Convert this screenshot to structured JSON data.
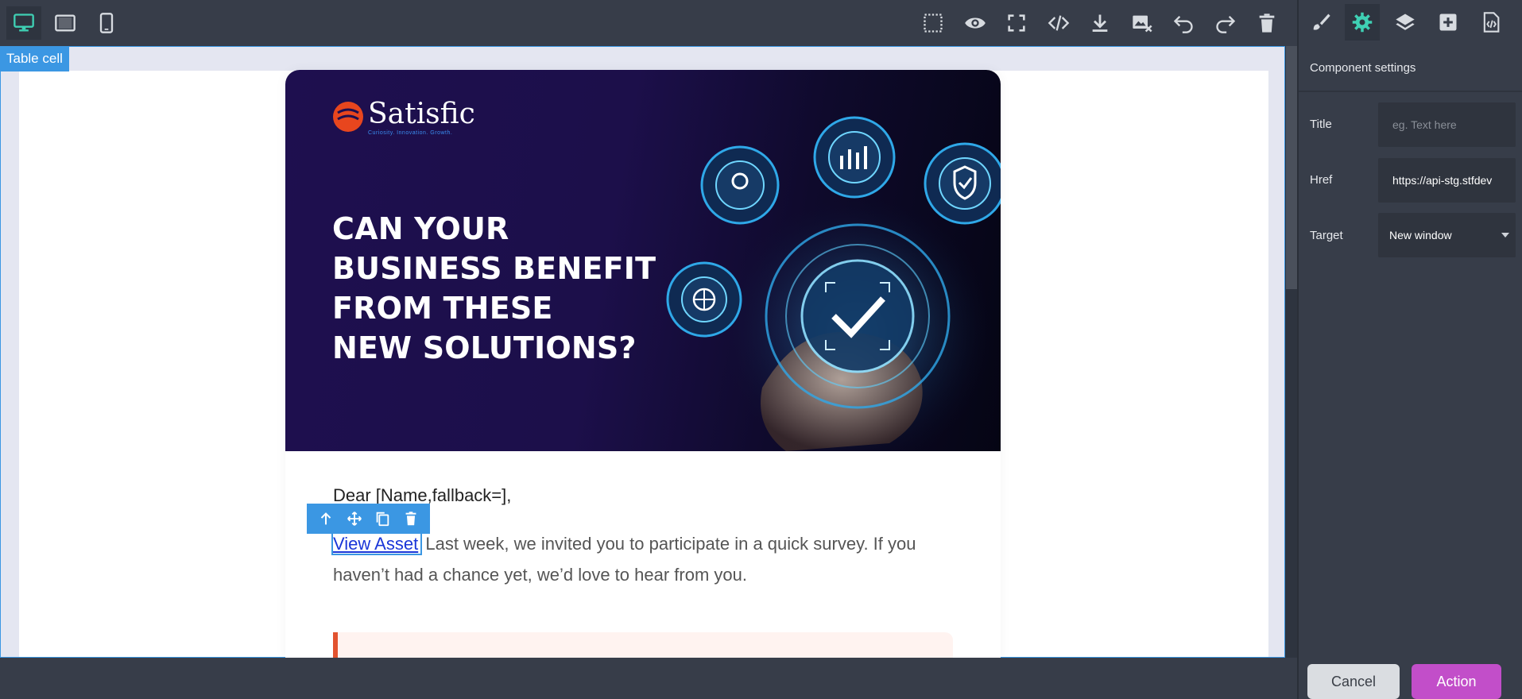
{
  "toolbar": {
    "device_buttons": [
      "desktop-icon",
      "tablet-icon",
      "mobile-icon"
    ],
    "action_buttons": [
      "select-outline-icon",
      "preview-eye-icon",
      "fullscreen-icon",
      "code-icon",
      "download-icon",
      "remove-image-icon",
      "undo-icon",
      "redo-icon",
      "trash-icon"
    ]
  },
  "panel": {
    "tabs": [
      "brush-icon",
      "gear-icon",
      "layers-icon",
      "add-block-icon",
      "custom-code-icon"
    ],
    "title": "Component settings",
    "traits": {
      "title_label": "Title",
      "title_placeholder": "eg. Text here",
      "href_label": "Href",
      "href_value": "https://api-stg.stfdev",
      "target_label": "Target",
      "target_value": "New window"
    }
  },
  "canvas": {
    "selected_badge": "Table cell",
    "email": {
      "logo_text": "Satisfic",
      "logo_tagline": "Curiosity. Innovation. Growth.",
      "headline_lines": [
        "CAN YOUR",
        "BUSINESS BENEFIT",
        "FROM THESE",
        "NEW SOLUTIONS?"
      ],
      "greeting": "Dear [Name,fallback=],",
      "link_text": "View Asset",
      "body_text": "Last week, we invited you to participate in a quick survey. If you haven’t had a chance yet, we’d love to hear from you."
    }
  },
  "footer": {
    "cancel_label": "Cancel",
    "action_label": "Action"
  },
  "colors": {
    "accent_blue": "#3b97e3",
    "teal_active": "#3fd0b4",
    "action_purple": "#c24ec9",
    "callout_orange": "#e2532f"
  }
}
